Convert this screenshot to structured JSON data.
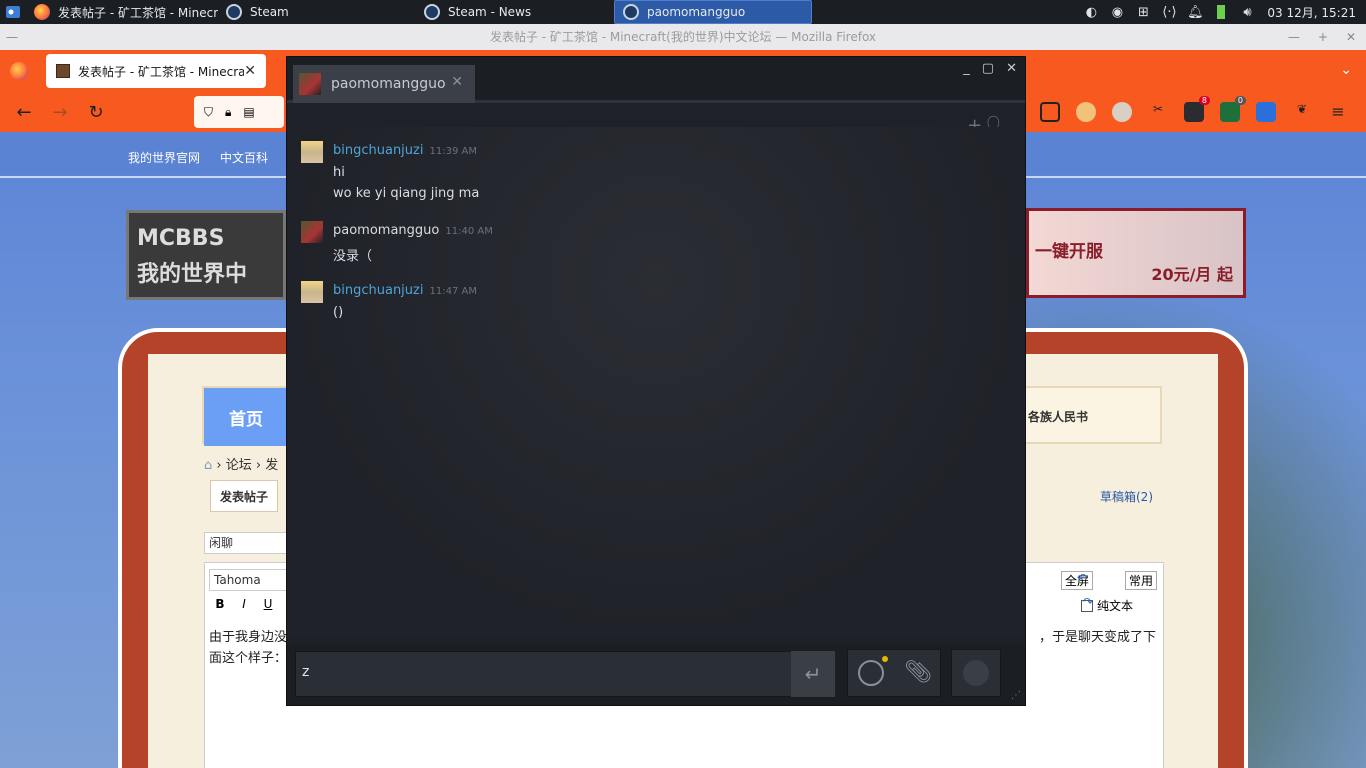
{
  "taskbar": {
    "tasks": [
      {
        "label": "发表帖子 - 矿工茶馆 - Minecr",
        "icon": "firefox-icon"
      },
      {
        "label": "Steam",
        "icon": "steam-icon"
      },
      {
        "label": "Steam - News",
        "icon": "steam-icon"
      },
      {
        "label": "paomomangguo",
        "icon": "steam-icon"
      }
    ],
    "clock": "03 12月, 15:21"
  },
  "firefox": {
    "window_title": "发表帖子 - 矿工茶馆 - Minecraft(我的世界)中文论坛 — Mozilla Firefox",
    "tab_title": "发表帖子 - 矿工茶馆 - Minecraft",
    "tab_close": "✕",
    "ext_badges": [
      "8",
      "0"
    ]
  },
  "forum": {
    "topnav": [
      "我的世界官网",
      "中文百科"
    ],
    "logo_text": "MCBBS\n我的世界中",
    "banner_text": "一键开服",
    "banner_price": "20元/月 起",
    "home": "首页",
    "renmin": "各族人民书",
    "breadcrumb": [
      "论坛",
      "发"
    ],
    "tab_post": "发表帖子",
    "drafts": "草稿箱(2)",
    "subject_value": "闲聊",
    "editor": {
      "font": "Tahoma",
      "fullscreen": "全屏",
      "common": "常用",
      "plain_text": "纯文本",
      "line1_left": "由于我身边没",
      "line1_right": "，于是聊天变成了下",
      "line2": "面这个样子："
    }
  },
  "chat": {
    "tab_name": "paomomangguo",
    "messages": [
      {
        "author": "bingchuanjuzi",
        "time": "11:39 AM",
        "lines": [
          "hi",
          "wo ke yi qiang jing ma"
        ],
        "color": "#4fa4d8"
      },
      {
        "author": "paomomangguo",
        "time": "11:40 AM",
        "lines": [
          "没录（"
        ],
        "color": "#d8dbe0"
      },
      {
        "author": "bingchuanjuzi",
        "time": "11:47 AM",
        "lines": [
          "()"
        ],
        "color": "#4fa4d8"
      }
    ],
    "input_value": "z",
    "send_symbol": "↵"
  }
}
